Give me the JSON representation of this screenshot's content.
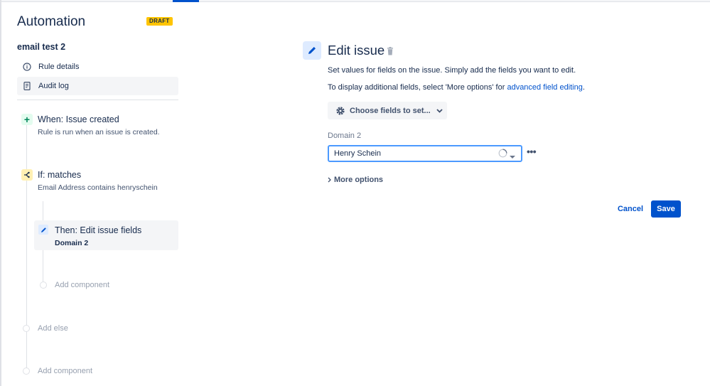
{
  "sidebar": {
    "title": "Automation",
    "badge": "DRAFT",
    "rule_name": "email test 2",
    "nav": [
      {
        "label": "Rule details",
        "icon": "info-icon"
      },
      {
        "label": "Audit log",
        "icon": "document-icon"
      }
    ],
    "trigger": {
      "title": "When: Issue created",
      "subtitle": "Rule is run when an issue is created.",
      "icon": "plus-icon"
    },
    "condition": {
      "title": "If: matches",
      "subtitle": "Email Address contains henryschein",
      "icon": "branch-icon"
    },
    "action": {
      "title": "Then: Edit issue fields",
      "subtitle": "Domain 2",
      "icon": "pencil-icon"
    },
    "add_component_inner": "Add component",
    "add_else": "Add else",
    "add_component_outer": "Add component"
  },
  "main": {
    "title": "Edit issue",
    "description": "Set values for fields on the issue. Simply add the fields you want to edit.",
    "description2_prefix": "To display additional fields, select 'More options' for ",
    "description2_link": "advanced field editing",
    "description2_suffix": ".",
    "choose_fields_label": "Choose fields to set...",
    "field": {
      "label": "Domain 2",
      "value": "Henry Schein"
    },
    "more_options_label": "More options",
    "cancel_label": "Cancel",
    "save_label": "Save"
  },
  "colors": {
    "accent": "#0052cc",
    "draft_badge": "#ffc400",
    "trigger_green": "#00875a",
    "condition_yellow": "#fff0b3"
  }
}
